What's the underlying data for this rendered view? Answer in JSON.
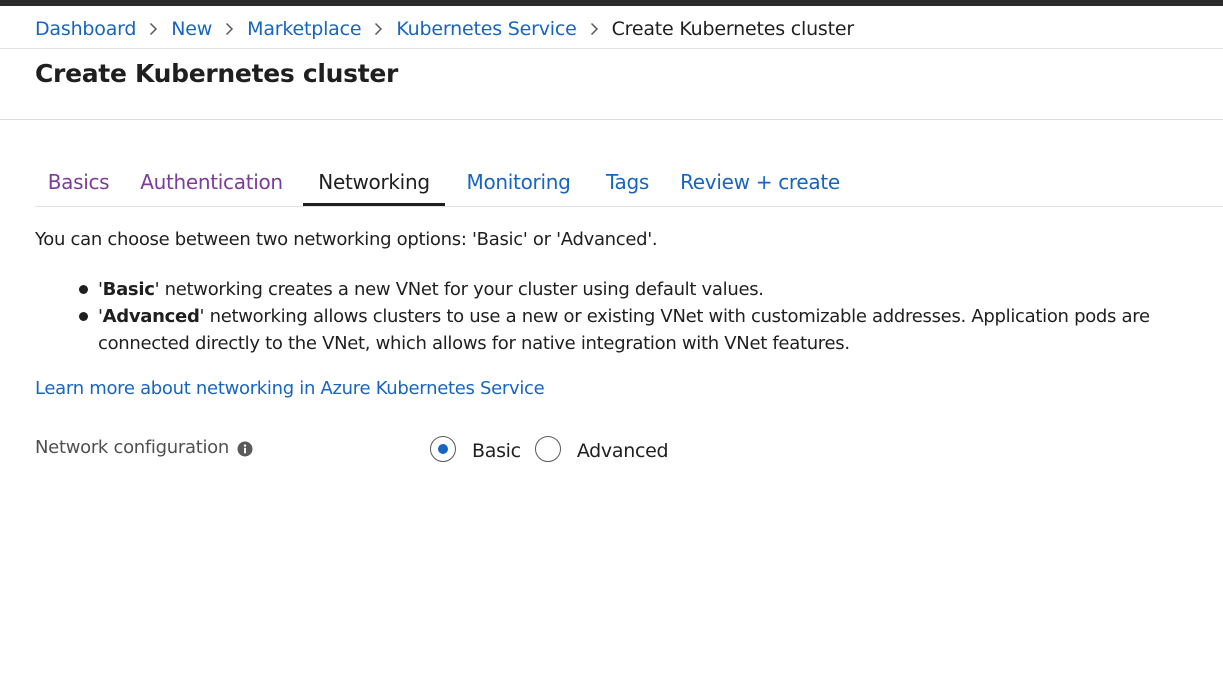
{
  "breadcrumb": {
    "items": [
      {
        "label": "Dashboard"
      },
      {
        "label": "New"
      },
      {
        "label": "Marketplace"
      },
      {
        "label": "Kubernetes Service"
      }
    ],
    "current": "Create Kubernetes cluster"
  },
  "page": {
    "title": "Create Kubernetes cluster"
  },
  "tabs": [
    {
      "label": "Basics",
      "state": "visited"
    },
    {
      "label": "Authentication",
      "state": "visited"
    },
    {
      "label": "Networking",
      "state": "active"
    },
    {
      "label": "Monitoring",
      "state": "link"
    },
    {
      "label": "Tags",
      "state": "link"
    },
    {
      "label": "Review + create",
      "state": "link"
    }
  ],
  "content": {
    "intro": "You can choose between two networking options: 'Basic' or 'Advanced'.",
    "bullets": [
      {
        "prefix": "'",
        "bold": "Basic",
        "text": "' networking creates a new VNet for your cluster using default values."
      },
      {
        "prefix": "'",
        "bold": "Advanced",
        "text": "' networking allows clusters to use a new or existing VNet with customizable addresses. Application pods are connected directly to the VNet, which allows for native integration with VNet features."
      }
    ],
    "learn_more": "Learn more about networking in Azure Kubernetes Service"
  },
  "network_config": {
    "label": "Network configuration",
    "info_icon": "info-icon",
    "options": [
      {
        "label": "Basic",
        "selected": true
      },
      {
        "label": "Advanced",
        "selected": false
      }
    ]
  },
  "colors": {
    "link": "#1765c1",
    "visited": "#7d3c98",
    "text": "#1f1f1f",
    "label": "#505050",
    "radio_selected": "#1765c1",
    "top_bar": "#2b2b2b"
  }
}
